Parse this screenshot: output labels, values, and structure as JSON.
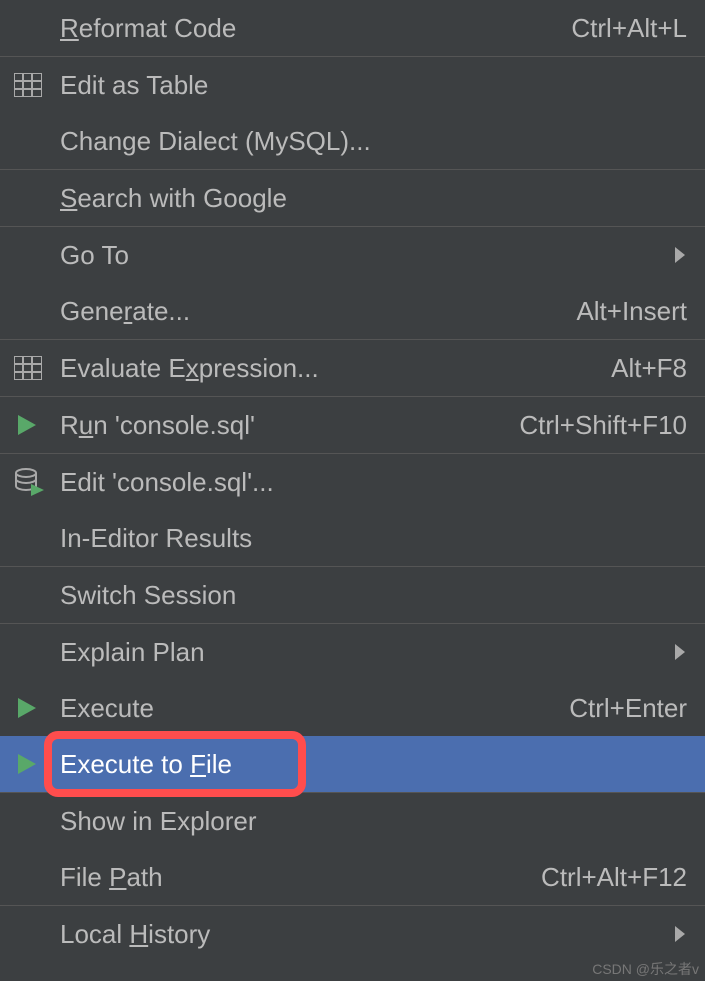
{
  "menu": {
    "items": [
      {
        "label_pre": "",
        "mnemonic": "R",
        "label_post": "eformat Code",
        "shortcut": "Ctrl+Alt+L",
        "icon": "",
        "arrow": false
      },
      {
        "separator": true
      },
      {
        "label_pre": "Edit as Table",
        "mnemonic": "",
        "label_post": "",
        "shortcut": "",
        "icon": "table",
        "arrow": false
      },
      {
        "label_pre": "Change Dialect (MySQL)...",
        "mnemonic": "",
        "label_post": "",
        "shortcut": "",
        "icon": "",
        "arrow": false
      },
      {
        "separator": true
      },
      {
        "label_pre": "",
        "mnemonic": "S",
        "label_post": "earch with Google",
        "shortcut": "",
        "icon": "",
        "arrow": false
      },
      {
        "separator": true
      },
      {
        "label_pre": "Go To",
        "mnemonic": "",
        "label_post": "",
        "shortcut": "",
        "icon": "",
        "arrow": true
      },
      {
        "label_pre": "Gene",
        "mnemonic": "r",
        "label_post": "ate...",
        "shortcut": "Alt+Insert",
        "icon": "",
        "arrow": false
      },
      {
        "separator": true
      },
      {
        "label_pre": "Evaluate E",
        "mnemonic": "x",
        "label_post": "pression...",
        "shortcut": "Alt+F8",
        "icon": "table",
        "arrow": false
      },
      {
        "separator": true
      },
      {
        "label_pre": "R",
        "mnemonic": "u",
        "label_post": "n 'console.sql'",
        "shortcut": "Ctrl+Shift+F10",
        "icon": "run",
        "arrow": false
      },
      {
        "separator": true
      },
      {
        "label_pre": "Edit 'console.sql'...",
        "mnemonic": "",
        "label_post": "",
        "shortcut": "",
        "icon": "db-run",
        "arrow": false
      },
      {
        "label_pre": "In-Editor Results",
        "mnemonic": "",
        "label_post": "",
        "shortcut": "",
        "icon": "",
        "arrow": false
      },
      {
        "separator": true
      },
      {
        "label_pre": "Switch Session",
        "mnemonic": "",
        "label_post": "",
        "shortcut": "",
        "icon": "",
        "arrow": false
      },
      {
        "separator": true
      },
      {
        "label_pre": "Explain Plan",
        "mnemonic": "",
        "label_post": "",
        "shortcut": "",
        "icon": "",
        "arrow": true
      },
      {
        "label_pre": "Execute",
        "mnemonic": "",
        "label_post": "",
        "shortcut": "Ctrl+Enter",
        "icon": "run",
        "arrow": false
      },
      {
        "label_pre": "Execute to ",
        "mnemonic": "F",
        "label_post": "ile",
        "shortcut": "",
        "icon": "run",
        "arrow": false,
        "selected": true
      },
      {
        "separator": true
      },
      {
        "label_pre": "Show in Explorer",
        "mnemonic": "",
        "label_post": "",
        "shortcut": "",
        "icon": "",
        "arrow": false
      },
      {
        "label_pre": "File ",
        "mnemonic": "P",
        "label_post": "ath",
        "shortcut": "Ctrl+Alt+F12",
        "icon": "",
        "arrow": false
      },
      {
        "separator": true
      },
      {
        "label_pre": "Local ",
        "mnemonic": "H",
        "label_post": "istory",
        "shortcut": "",
        "icon": "",
        "arrow": true
      }
    ]
  },
  "watermark": "CSDN @乐之者v"
}
